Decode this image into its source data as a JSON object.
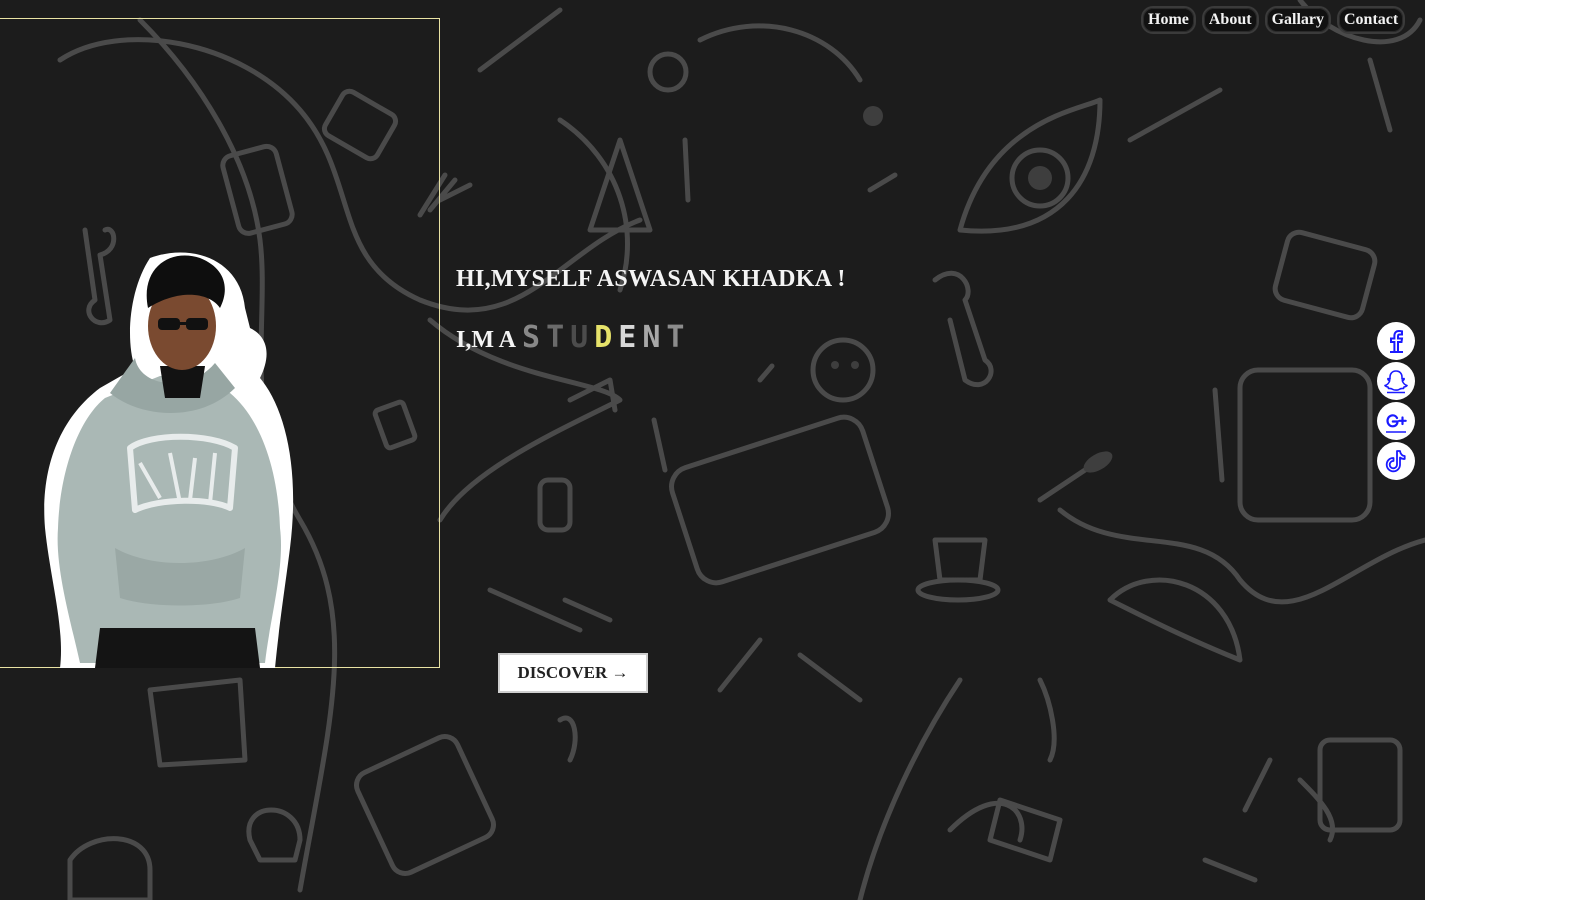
{
  "nav": {
    "items": [
      "Home",
      "About",
      "Gallary",
      "Contact"
    ]
  },
  "hero": {
    "greeting": "HI,MYSELF ASWASAN KHADKA !",
    "role_prefix": "I,M A",
    "role_letters": [
      "S",
      "T",
      "U",
      "D",
      "E",
      "N",
      "T"
    ],
    "role_letter_colors": [
      "#888888",
      "#6a6a6a",
      "#4c4c4c",
      "#e6e26a",
      "#d8d8d8",
      "#a8a8a8",
      "#8c8c8c"
    ],
    "discover_label": "DISCOVER →"
  },
  "social": {
    "icons": [
      "facebook-icon",
      "snapchat-icon",
      "google-plus-icon",
      "tiktok-icon"
    ]
  },
  "colors": {
    "background": "#1c1c1c",
    "frame_border": "#e9e3a4",
    "social_icon": "#1a1aff",
    "accent_letter": "#e6e26a"
  }
}
